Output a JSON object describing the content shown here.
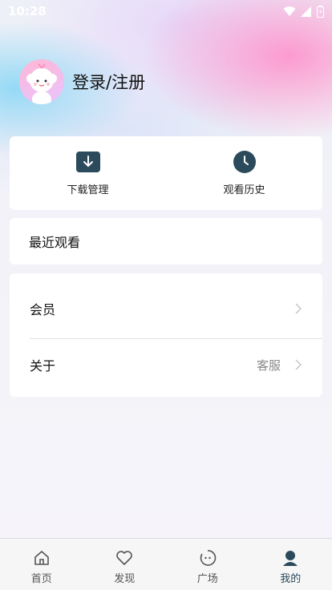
{
  "status_bar": {
    "time": "10:28"
  },
  "profile": {
    "login_label": "登录/注册"
  },
  "quick_actions": [
    {
      "label": "下载管理",
      "icon": "download-icon"
    },
    {
      "label": "观看历史",
      "icon": "clock-icon"
    }
  ],
  "recent": {
    "label": "最近观看"
  },
  "menu": {
    "member_label": "会员",
    "about_label": "关于",
    "service_label": "客服"
  },
  "tabbar": {
    "tabs": [
      {
        "label": "首页",
        "icon": "home-icon"
      },
      {
        "label": "发现",
        "icon": "heart-icon"
      },
      {
        "label": "广场",
        "icon": "smile-icon"
      },
      {
        "label": "我的",
        "icon": "user-icon",
        "active": true
      }
    ]
  },
  "colors": {
    "accent": "#2b4a5c",
    "card": "#ffffff"
  }
}
